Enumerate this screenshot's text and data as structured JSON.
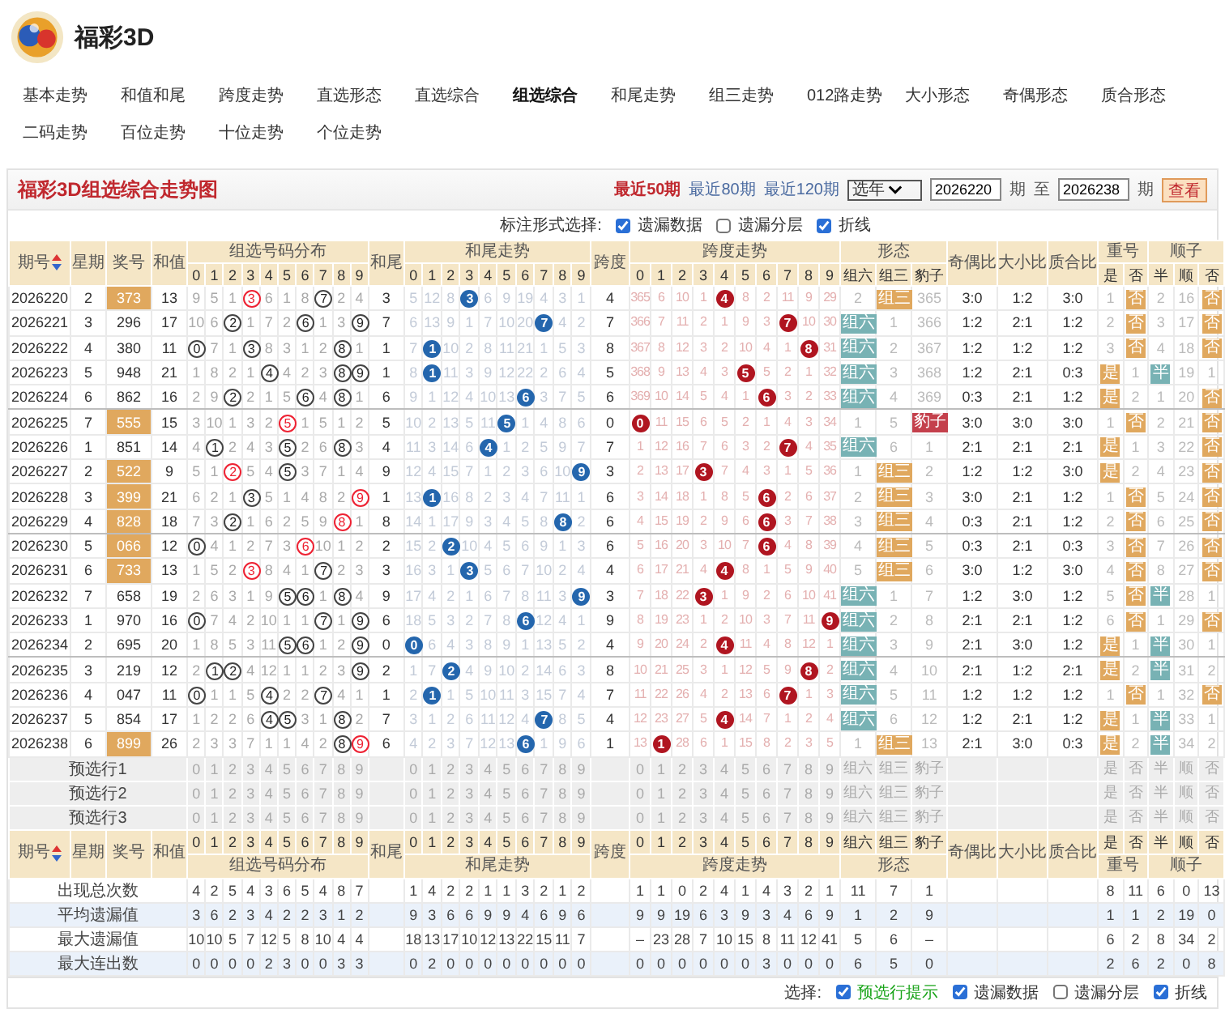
{
  "app": {
    "title": "福彩3D"
  },
  "nav": [
    {
      "label": "基本走势",
      "selected": false
    },
    {
      "label": "和值和尾",
      "selected": false
    },
    {
      "label": "跨度走势",
      "selected": false
    },
    {
      "label": "直选形态",
      "selected": false
    },
    {
      "label": "直选综合",
      "selected": false
    },
    {
      "label": "组选综合",
      "selected": true
    },
    {
      "label": "和尾走势",
      "selected": false
    },
    {
      "label": "组三走势",
      "selected": false
    },
    {
      "label": "012路走势",
      "selected": false
    },
    {
      "label": "大小形态",
      "selected": false
    },
    {
      "label": "奇偶形态",
      "selected": false
    },
    {
      "label": "质合形态",
      "selected": false
    },
    {
      "label": "二码走势",
      "selected": false
    },
    {
      "label": "百位走势",
      "selected": false
    },
    {
      "label": "十位走势",
      "selected": false
    },
    {
      "label": "个位走势",
      "selected": false
    }
  ],
  "panel": {
    "title": "福彩3D组选综合走势图",
    "ranges": [
      {
        "label": "最近50期",
        "selected": true
      },
      {
        "label": "最近80期",
        "selected": false
      },
      {
        "label": "最近120期",
        "selected": false
      }
    ],
    "year_select": "选年",
    "from": "2026220",
    "from_unit": "期",
    "to_label": "至",
    "to": "2026238",
    "to_unit": "期",
    "view_button": "查看"
  },
  "mark_options": {
    "label": "标注形式选择:",
    "items": [
      {
        "label": "遗漏数据",
        "checked": true
      },
      {
        "label": "遗漏分层",
        "checked": false
      },
      {
        "label": "折线",
        "checked": true
      }
    ]
  },
  "table": {
    "header": {
      "period": "期号",
      "week": "星期",
      "number": "奖号",
      "sum": "和值",
      "dist_title": "组选号码分布",
      "dist_digits": [
        "0",
        "1",
        "2",
        "3",
        "4",
        "5",
        "6",
        "7",
        "8",
        "9"
      ],
      "tail": "和尾",
      "tail_title": "和尾走势",
      "tail_digits": [
        "0",
        "1",
        "2",
        "3",
        "4",
        "5",
        "6",
        "7",
        "8",
        "9"
      ],
      "span": "跨度",
      "span_title": "跨度走势",
      "span_digits": [
        "0",
        "1",
        "2",
        "3",
        "4",
        "5",
        "6",
        "7",
        "8",
        "9"
      ],
      "form_title": "形态",
      "form_cols": [
        "组六",
        "组三",
        "豹子"
      ],
      "odd_even": "奇偶比",
      "big_small": "大小比",
      "prime": "质合比",
      "repeat_title": "重号",
      "repeat_cols": [
        "是",
        "否"
      ],
      "seq_title": "顺子",
      "seq_cols": [
        "半",
        "顺",
        "否"
      ]
    },
    "rows": [
      {
        "period": "2026220",
        "weekday": "2",
        "number": "373",
        "highlight": true,
        "sum": "13",
        "dist": [
          "9",
          "5",
          "1",
          {
            "t": "3",
            "hit": true,
            "double": true
          },
          "6",
          "1",
          "8",
          {
            "t": "7",
            "hit": true,
            "double": false
          },
          "2",
          "4"
        ],
        "tail": "3",
        "tail_trend": [
          "5",
          "12",
          "8",
          {
            "t": "3",
            "hit": true
          },
          "6",
          "9",
          "19",
          "4",
          "3",
          "1"
        ],
        "span": "4",
        "span_trend": [
          "365",
          "6",
          "10",
          "1",
          {
            "t": "4",
            "hit": true
          },
          "8",
          "2",
          "11",
          "9",
          "29"
        ],
        "form": [
          "2",
          {
            "t": "组三",
            "hit": true
          },
          "365"
        ],
        "odd_even": "3:0",
        "big_small": "1:2",
        "prime": "3:0",
        "repeat": [
          "1",
          {
            "t": "否",
            "hit": true
          }
        ],
        "sequence": [
          "2",
          "16",
          {
            "t": "否",
            "hit": true
          }
        ]
      },
      {
        "period": "2026221",
        "weekday": "3",
        "number": "296",
        "highlight": false,
        "sum": "17",
        "dist": [
          "10",
          "6",
          {
            "t": "2",
            "hit": true,
            "double": false
          },
          "1",
          "7",
          "2",
          {
            "t": "6",
            "hit": true,
            "double": false
          },
          "1",
          "3",
          {
            "t": "9",
            "hit": true,
            "double": false
          }
        ],
        "tail": "7",
        "tail_trend": [
          "6",
          "13",
          "9",
          "1",
          "7",
          "10",
          "20",
          {
            "t": "7",
            "hit": true
          },
          "4",
          "2"
        ],
        "span": "7",
        "span_trend": [
          "366",
          "7",
          "11",
          "2",
          "1",
          "9",
          "3",
          {
            "t": "7",
            "hit": true
          },
          "10",
          "30"
        ],
        "form": [
          {
            "t": "组六",
            "hit": true
          },
          "1",
          "366"
        ],
        "odd_even": "1:2",
        "big_small": "2:1",
        "prime": "1:2",
        "repeat": [
          "2",
          {
            "t": "否",
            "hit": true
          }
        ],
        "sequence": [
          "3",
          "17",
          {
            "t": "否",
            "hit": true
          }
        ]
      },
      {
        "period": "2026222",
        "weekday": "4",
        "number": "380",
        "highlight": false,
        "sum": "11",
        "dist": [
          {
            "t": "0",
            "hit": true,
            "double": false
          },
          "7",
          "1",
          {
            "t": "3",
            "hit": true,
            "double": false
          },
          "8",
          "3",
          "1",
          "2",
          {
            "t": "8",
            "hit": true,
            "double": false
          },
          "1"
        ],
        "tail": "1",
        "tail_trend": [
          "7",
          {
            "t": "1",
            "hit": true
          },
          "10",
          "2",
          "8",
          "11",
          "21",
          "1",
          "5",
          "3"
        ],
        "span": "8",
        "span_trend": [
          "367",
          "8",
          "12",
          "3",
          "2",
          "10",
          "4",
          "1",
          {
            "t": "8",
            "hit": true
          },
          "31"
        ],
        "form": [
          {
            "t": "组六",
            "hit": true
          },
          "2",
          "367"
        ],
        "odd_even": "1:2",
        "big_small": "1:2",
        "prime": "1:2",
        "repeat": [
          "3",
          {
            "t": "否",
            "hit": true
          }
        ],
        "sequence": [
          "4",
          "18",
          {
            "t": "否",
            "hit": true
          }
        ]
      },
      {
        "period": "2026223",
        "weekday": "5",
        "number": "948",
        "highlight": false,
        "sum": "21",
        "dist": [
          "1",
          "8",
          "2",
          "1",
          {
            "t": "4",
            "hit": true,
            "double": false
          },
          "4",
          "2",
          "3",
          {
            "t": "8",
            "hit": true,
            "double": false
          },
          {
            "t": "9",
            "hit": true,
            "double": false
          }
        ],
        "tail": "1",
        "tail_trend": [
          "8",
          {
            "t": "1",
            "hit": true
          },
          "11",
          "3",
          "9",
          "12",
          "22",
          "2",
          "6",
          "4"
        ],
        "span": "5",
        "span_trend": [
          "368",
          "9",
          "13",
          "4",
          "3",
          {
            "t": "5",
            "hit": true
          },
          "5",
          "2",
          "1",
          "32"
        ],
        "form": [
          {
            "t": "组六",
            "hit": true
          },
          "3",
          "368"
        ],
        "odd_even": "1:2",
        "big_small": "2:1",
        "prime": "0:3",
        "repeat": [
          {
            "t": "是",
            "hit": true
          },
          "1"
        ],
        "sequence": [
          {
            "t": "半",
            "hit": true
          },
          "19",
          "1"
        ]
      },
      {
        "period": "2026224",
        "weekday": "6",
        "number": "862",
        "highlight": false,
        "sum": "16",
        "dist": [
          "2",
          "9",
          {
            "t": "2",
            "hit": true,
            "double": false
          },
          "2",
          "1",
          "5",
          {
            "t": "6",
            "hit": true,
            "double": false
          },
          "4",
          {
            "t": "8",
            "hit": true,
            "double": false
          },
          "1"
        ],
        "tail": "6",
        "tail_trend": [
          "9",
          "1",
          "12",
          "4",
          "10",
          "13",
          {
            "t": "6",
            "hit": true
          },
          "3",
          "7",
          "5"
        ],
        "span": "6",
        "span_trend": [
          "369",
          "10",
          "14",
          "5",
          "4",
          "1",
          {
            "t": "6",
            "hit": true
          },
          "3",
          "2",
          "33"
        ],
        "form": [
          {
            "t": "组六",
            "hit": true
          },
          "4",
          "369"
        ],
        "odd_even": "0:3",
        "big_small": "2:1",
        "prime": "1:2",
        "repeat": [
          {
            "t": "是",
            "hit": true
          },
          "2"
        ],
        "sequence": [
          "1",
          "20",
          {
            "t": "否",
            "hit": true
          }
        ]
      },
      {
        "period": "2026225",
        "weekday": "7",
        "number": "555",
        "highlight": true,
        "sum": "15",
        "dist": [
          "3",
          "10",
          "1",
          "3",
          "2",
          {
            "t": "5",
            "hit": true,
            "double": true
          },
          "1",
          "5",
          "1",
          "2"
        ],
        "tail": "5",
        "tail_trend": [
          "10",
          "2",
          "13",
          "5",
          "11",
          {
            "t": "5",
            "hit": true
          },
          "1",
          "4",
          "8",
          "6"
        ],
        "span": "0",
        "span_trend": [
          {
            "t": "0",
            "hit": true
          },
          "11",
          "15",
          "6",
          "5",
          "2",
          "1",
          "4",
          "3",
          "34"
        ],
        "form": [
          "1",
          "5",
          {
            "t": "豹子",
            "hit": true
          }
        ],
        "odd_even": "3:0",
        "big_small": "3:0",
        "prime": "3:0",
        "repeat": [
          "1",
          {
            "t": "否",
            "hit": true
          }
        ],
        "sequence": [
          "2",
          "21",
          {
            "t": "否",
            "hit": true
          }
        ]
      },
      {
        "period": "2026226",
        "weekday": "1",
        "number": "851",
        "highlight": false,
        "sum": "14",
        "dist": [
          "4",
          {
            "t": "1",
            "hit": true,
            "double": false
          },
          "2",
          "4",
          "3",
          {
            "t": "5",
            "hit": true,
            "double": false
          },
          "2",
          "6",
          {
            "t": "8",
            "hit": true,
            "double": false
          },
          "3"
        ],
        "tail": "4",
        "tail_trend": [
          "11",
          "3",
          "14",
          "6",
          {
            "t": "4",
            "hit": true
          },
          "1",
          "2",
          "5",
          "9",
          "7"
        ],
        "span": "7",
        "span_trend": [
          "1",
          "12",
          "16",
          "7",
          "6",
          "3",
          "2",
          {
            "t": "7",
            "hit": true
          },
          "4",
          "35"
        ],
        "form": [
          {
            "t": "组六",
            "hit": true
          },
          "6",
          "1"
        ],
        "odd_even": "2:1",
        "big_small": "2:1",
        "prime": "2:1",
        "repeat": [
          {
            "t": "是",
            "hit": true
          },
          "1"
        ],
        "sequence": [
          "3",
          "22",
          {
            "t": "否",
            "hit": true
          }
        ]
      },
      {
        "period": "2026227",
        "weekday": "2",
        "number": "522",
        "highlight": true,
        "sum": "9",
        "dist": [
          "5",
          "1",
          {
            "t": "2",
            "hit": true,
            "double": true
          },
          "5",
          "4",
          {
            "t": "5",
            "hit": true,
            "double": false
          },
          "3",
          "7",
          "1",
          "4"
        ],
        "tail": "9",
        "tail_trend": [
          "12",
          "4",
          "15",
          "7",
          "1",
          "2",
          "3",
          "6",
          "10",
          {
            "t": "9",
            "hit": true
          }
        ],
        "span": "3",
        "span_trend": [
          "2",
          "13",
          "17",
          {
            "t": "3",
            "hit": true
          },
          "7",
          "4",
          "3",
          "1",
          "5",
          "36"
        ],
        "form": [
          "1",
          {
            "t": "组三",
            "hit": true
          },
          "2"
        ],
        "odd_even": "1:2",
        "big_small": "1:2",
        "prime": "3:0",
        "repeat": [
          {
            "t": "是",
            "hit": true
          },
          "2"
        ],
        "sequence": [
          "4",
          "23",
          {
            "t": "否",
            "hit": true
          }
        ]
      },
      {
        "period": "2026228",
        "weekday": "3",
        "number": "399",
        "highlight": true,
        "sum": "21",
        "dist": [
          "6",
          "2",
          "1",
          {
            "t": "3",
            "hit": true,
            "double": false
          },
          "5",
          "1",
          "4",
          "8",
          "2",
          {
            "t": "9",
            "hit": true,
            "double": true
          }
        ],
        "tail": "1",
        "tail_trend": [
          "13",
          {
            "t": "1",
            "hit": true
          },
          "16",
          "8",
          "2",
          "3",
          "4",
          "7",
          "11",
          "1"
        ],
        "span": "6",
        "span_trend": [
          "3",
          "14",
          "18",
          "1",
          "8",
          "5",
          {
            "t": "6",
            "hit": true
          },
          "2",
          "6",
          "37"
        ],
        "form": [
          "2",
          {
            "t": "组三",
            "hit": true
          },
          "3"
        ],
        "odd_even": "3:0",
        "big_small": "2:1",
        "prime": "1:2",
        "repeat": [
          "1",
          {
            "t": "否",
            "hit": true
          }
        ],
        "sequence": [
          "5",
          "24",
          {
            "t": "否",
            "hit": true
          }
        ]
      },
      {
        "period": "2026229",
        "weekday": "4",
        "number": "828",
        "highlight": true,
        "sum": "18",
        "dist": [
          "7",
          "3",
          {
            "t": "2",
            "hit": true,
            "double": false
          },
          "1",
          "6",
          "2",
          "5",
          "9",
          {
            "t": "8",
            "hit": true,
            "double": true
          },
          "1"
        ],
        "tail": "8",
        "tail_trend": [
          "14",
          "1",
          "17",
          "9",
          "3",
          "4",
          "5",
          "8",
          {
            "t": "8",
            "hit": true
          },
          "2"
        ],
        "span": "6",
        "span_trend": [
          "4",
          "15",
          "19",
          "2",
          "9",
          "6",
          {
            "t": "6",
            "hit": true
          },
          "3",
          "7",
          "38"
        ],
        "form": [
          "3",
          {
            "t": "组三",
            "hit": true
          },
          "4"
        ],
        "odd_even": "0:3",
        "big_small": "2:1",
        "prime": "1:2",
        "repeat": [
          "2",
          {
            "t": "否",
            "hit": true
          }
        ],
        "sequence": [
          "6",
          "25",
          {
            "t": "否",
            "hit": true
          }
        ]
      },
      {
        "period": "2026230",
        "weekday": "5",
        "number": "066",
        "highlight": true,
        "sum": "12",
        "dist": [
          {
            "t": "0",
            "hit": true,
            "double": false
          },
          "4",
          "1",
          "2",
          "7",
          "3",
          {
            "t": "6",
            "hit": true,
            "double": true
          },
          "10",
          "1",
          "2"
        ],
        "tail": "2",
        "tail_trend": [
          "15",
          "2",
          {
            "t": "2",
            "hit": true
          },
          "10",
          "4",
          "5",
          "6",
          "9",
          "1",
          "3"
        ],
        "span": "6",
        "span_trend": [
          "5",
          "16",
          "20",
          "3",
          "10",
          "7",
          {
            "t": "6",
            "hit": true
          },
          "4",
          "8",
          "39"
        ],
        "form": [
          "4",
          {
            "t": "组三",
            "hit": true
          },
          "5"
        ],
        "odd_even": "0:3",
        "big_small": "2:1",
        "prime": "0:3",
        "repeat": [
          "3",
          {
            "t": "否",
            "hit": true
          }
        ],
        "sequence": [
          "7",
          "26",
          {
            "t": "否",
            "hit": true
          }
        ]
      },
      {
        "period": "2026231",
        "weekday": "6",
        "number": "733",
        "highlight": true,
        "sum": "13",
        "dist": [
          "1",
          "5",
          "2",
          {
            "t": "3",
            "hit": true,
            "double": true
          },
          "8",
          "4",
          "1",
          {
            "t": "7",
            "hit": true,
            "double": false
          },
          "2",
          "3"
        ],
        "tail": "3",
        "tail_trend": [
          "16",
          "3",
          "1",
          {
            "t": "3",
            "hit": true
          },
          "5",
          "6",
          "7",
          "10",
          "2",
          "4"
        ],
        "span": "4",
        "span_trend": [
          "6",
          "17",
          "21",
          "4",
          {
            "t": "4",
            "hit": true
          },
          "8",
          "1",
          "5",
          "9",
          "40"
        ],
        "form": [
          "5",
          {
            "t": "组三",
            "hit": true
          },
          "6"
        ],
        "odd_even": "3:0",
        "big_small": "1:2",
        "prime": "3:0",
        "repeat": [
          "4",
          {
            "t": "否",
            "hit": true
          }
        ],
        "sequence": [
          "8",
          "27",
          {
            "t": "否",
            "hit": true
          }
        ]
      },
      {
        "period": "2026232",
        "weekday": "7",
        "number": "658",
        "highlight": false,
        "sum": "19",
        "dist": [
          "2",
          "6",
          "3",
          "1",
          "9",
          {
            "t": "5",
            "hit": true,
            "double": false
          },
          {
            "t": "6",
            "hit": true,
            "double": false
          },
          "1",
          {
            "t": "8",
            "hit": true,
            "double": false
          },
          "4"
        ],
        "tail": "9",
        "tail_trend": [
          "17",
          "4",
          "2",
          "1",
          "6",
          "7",
          "8",
          "11",
          "3",
          {
            "t": "9",
            "hit": true
          }
        ],
        "span": "3",
        "span_trend": [
          "7",
          "18",
          "22",
          {
            "t": "3",
            "hit": true
          },
          "1",
          "9",
          "2",
          "6",
          "10",
          "41"
        ],
        "form": [
          {
            "t": "组六",
            "hit": true
          },
          "1",
          "7"
        ],
        "odd_even": "1:2",
        "big_small": "3:0",
        "prime": "1:2",
        "repeat": [
          "5",
          {
            "t": "否",
            "hit": true
          }
        ],
        "sequence": [
          {
            "t": "半",
            "hit": true
          },
          "28",
          "1"
        ]
      },
      {
        "period": "2026233",
        "weekday": "1",
        "number": "970",
        "highlight": false,
        "sum": "16",
        "dist": [
          {
            "t": "0",
            "hit": true,
            "double": false
          },
          "7",
          "4",
          "2",
          "10",
          "1",
          "1",
          {
            "t": "7",
            "hit": true,
            "double": false
          },
          "1",
          {
            "t": "9",
            "hit": true,
            "double": false
          }
        ],
        "tail": "6",
        "tail_trend": [
          "18",
          "5",
          "3",
          "2",
          "7",
          "8",
          {
            "t": "6",
            "hit": true
          },
          "12",
          "4",
          "1"
        ],
        "span": "9",
        "span_trend": [
          "8",
          "19",
          "23",
          "1",
          "2",
          "10",
          "3",
          "7",
          "11",
          {
            "t": "9",
            "hit": true
          }
        ],
        "form": [
          {
            "t": "组六",
            "hit": true
          },
          "2",
          "8"
        ],
        "odd_even": "2:1",
        "big_small": "2:1",
        "prime": "1:2",
        "repeat": [
          "6",
          {
            "t": "否",
            "hit": true
          }
        ],
        "sequence": [
          "1",
          "29",
          {
            "t": "否",
            "hit": true
          }
        ]
      },
      {
        "period": "2026234",
        "weekday": "2",
        "number": "695",
        "highlight": false,
        "sum": "20",
        "dist": [
          "1",
          "8",
          "5",
          "3",
          "11",
          {
            "t": "5",
            "hit": true,
            "double": false
          },
          {
            "t": "6",
            "hit": true,
            "double": false
          },
          "1",
          "2",
          {
            "t": "9",
            "hit": true,
            "double": false
          }
        ],
        "tail": "0",
        "tail_trend": [
          {
            "t": "0",
            "hit": true
          },
          "6",
          "4",
          "3",
          "8",
          "9",
          "1",
          "13",
          "5",
          "2"
        ],
        "span": "4",
        "span_trend": [
          "9",
          "20",
          "24",
          "2",
          {
            "t": "4",
            "hit": true
          },
          "11",
          "4",
          "8",
          "12",
          "1"
        ],
        "form": [
          {
            "t": "组六",
            "hit": true
          },
          "3",
          "9"
        ],
        "odd_even": "2:1",
        "big_small": "3:0",
        "prime": "1:2",
        "repeat": [
          {
            "t": "是",
            "hit": true
          },
          "1"
        ],
        "sequence": [
          {
            "t": "半",
            "hit": true
          },
          "30",
          "1"
        ]
      },
      {
        "period": "2026235",
        "weekday": "3",
        "number": "219",
        "highlight": false,
        "sum": "12",
        "dist": [
          "2",
          {
            "t": "1",
            "hit": true,
            "double": false
          },
          {
            "t": "2",
            "hit": true,
            "double": false
          },
          "4",
          "12",
          "1",
          "1",
          "2",
          "3",
          {
            "t": "9",
            "hit": true,
            "double": false
          }
        ],
        "tail": "2",
        "tail_trend": [
          "1",
          "7",
          {
            "t": "2",
            "hit": true
          },
          "4",
          "9",
          "10",
          "2",
          "14",
          "6",
          "3"
        ],
        "span": "8",
        "span_trend": [
          "10",
          "21",
          "25",
          "3",
          "1",
          "12",
          "5",
          "9",
          {
            "t": "8",
            "hit": true
          },
          "2"
        ],
        "form": [
          {
            "t": "组六",
            "hit": true
          },
          "4",
          "10"
        ],
        "odd_even": "2:1",
        "big_small": "1:2",
        "prime": "2:1",
        "repeat": [
          {
            "t": "是",
            "hit": true
          },
          "2"
        ],
        "sequence": [
          {
            "t": "半",
            "hit": true
          },
          "31",
          "2"
        ]
      },
      {
        "period": "2026236",
        "weekday": "4",
        "number": "047",
        "highlight": false,
        "sum": "11",
        "dist": [
          {
            "t": "0",
            "hit": true,
            "double": false
          },
          "1",
          "1",
          "5",
          {
            "t": "4",
            "hit": true,
            "double": false
          },
          "2",
          "2",
          {
            "t": "7",
            "hit": true,
            "double": false
          },
          "4",
          "1"
        ],
        "tail": "1",
        "tail_trend": [
          "2",
          {
            "t": "1",
            "hit": true
          },
          "1",
          "5",
          "10",
          "11",
          "3",
          "15",
          "7",
          "4"
        ],
        "span": "7",
        "span_trend": [
          "11",
          "22",
          "26",
          "4",
          "2",
          "13",
          "6",
          {
            "t": "7",
            "hit": true
          },
          "1",
          "3"
        ],
        "form": [
          {
            "t": "组六",
            "hit": true
          },
          "5",
          "11"
        ],
        "odd_even": "1:2",
        "big_small": "1:2",
        "prime": "1:2",
        "repeat": [
          "1",
          {
            "t": "否",
            "hit": true
          }
        ],
        "sequence": [
          "1",
          "32",
          {
            "t": "否",
            "hit": true
          }
        ]
      },
      {
        "period": "2026237",
        "weekday": "5",
        "number": "854",
        "highlight": false,
        "sum": "17",
        "dist": [
          "1",
          "2",
          "2",
          "6",
          {
            "t": "4",
            "hit": true,
            "double": false
          },
          {
            "t": "5",
            "hit": true,
            "double": false
          },
          "3",
          "1",
          {
            "t": "8",
            "hit": true,
            "double": false
          },
          "2"
        ],
        "tail": "7",
        "tail_trend": [
          "3",
          "1",
          "2",
          "6",
          "11",
          "12",
          "4",
          {
            "t": "7",
            "hit": true
          },
          "8",
          "5"
        ],
        "span": "4",
        "span_trend": [
          "12",
          "23",
          "27",
          "5",
          {
            "t": "4",
            "hit": true
          },
          "14",
          "7",
          "1",
          "2",
          "4"
        ],
        "form": [
          {
            "t": "组六",
            "hit": true
          },
          "6",
          "12"
        ],
        "odd_even": "1:2",
        "big_small": "2:1",
        "prime": "1:2",
        "repeat": [
          {
            "t": "是",
            "hit": true
          },
          "1"
        ],
        "sequence": [
          {
            "t": "半",
            "hit": true
          },
          "33",
          "1"
        ]
      },
      {
        "period": "2026238",
        "weekday": "6",
        "number": "899",
        "highlight": true,
        "sum": "26",
        "dist": [
          "2",
          "3",
          "3",
          "7",
          "1",
          "1",
          "4",
          "2",
          {
            "t": "8",
            "hit": true,
            "double": false
          },
          {
            "t": "9",
            "hit": true,
            "double": true
          }
        ],
        "tail": "6",
        "tail_trend": [
          "4",
          "2",
          "3",
          "7",
          "12",
          "13",
          {
            "t": "6",
            "hit": true
          },
          "1",
          "9",
          "6"
        ],
        "span": "1",
        "span_trend": [
          "13",
          {
            "t": "1",
            "hit": true
          },
          "28",
          "6",
          "1",
          "15",
          "8",
          "2",
          "3",
          "5"
        ],
        "form": [
          "1",
          {
            "t": "组三",
            "hit": true
          },
          "13"
        ],
        "odd_even": "2:1",
        "big_small": "3:0",
        "prime": "0:3",
        "repeat": [
          {
            "t": "是",
            "hit": true
          },
          "2"
        ],
        "sequence": [
          {
            "t": "半",
            "hit": true
          },
          "34",
          "2"
        ]
      }
    ],
    "preselect_rows": [
      {
        "label": "预选行1",
        "dist": [
          "0",
          "1",
          "2",
          "3",
          "4",
          "5",
          "6",
          "7",
          "8",
          "9"
        ],
        "tail_trend": [
          "0",
          "1",
          "2",
          "3",
          "4",
          "5",
          "6",
          "7",
          "8",
          "9"
        ],
        "span_trend": [
          "0",
          "1",
          "2",
          "3",
          "4",
          "5",
          "6",
          "7",
          "8",
          "9"
        ],
        "form": [
          "组六",
          "组三",
          "豹子"
        ],
        "repeat": [
          "是",
          "否"
        ],
        "sequence": [
          "半",
          "顺",
          "否"
        ]
      },
      {
        "label": "预选行2",
        "dist": [
          "0",
          "1",
          "2",
          "3",
          "4",
          "5",
          "6",
          "7",
          "8",
          "9"
        ],
        "tail_trend": [
          "0",
          "1",
          "2",
          "3",
          "4",
          "5",
          "6",
          "7",
          "8",
          "9"
        ],
        "span_trend": [
          "0",
          "1",
          "2",
          "3",
          "4",
          "5",
          "6",
          "7",
          "8",
          "9"
        ],
        "form": [
          "组六",
          "组三",
          "豹子"
        ],
        "repeat": [
          "是",
          "否"
        ],
        "sequence": [
          "半",
          "顺",
          "否"
        ]
      },
      {
        "label": "预选行3",
        "dist": [
          "0",
          "1",
          "2",
          "3",
          "4",
          "5",
          "6",
          "7",
          "8",
          "9"
        ],
        "tail_trend": [
          "0",
          "1",
          "2",
          "3",
          "4",
          "5",
          "6",
          "7",
          "8",
          "9"
        ],
        "span_trend": [
          "0",
          "1",
          "2",
          "3",
          "4",
          "5",
          "6",
          "7",
          "8",
          "9"
        ],
        "form": [
          "组六",
          "组三",
          "豹子"
        ],
        "repeat": [
          "是",
          "否"
        ],
        "sequence": [
          "半",
          "顺",
          "否"
        ]
      }
    ],
    "footer_header": {
      "period": "期号",
      "week": "星期",
      "number": "奖号",
      "sum": "和值",
      "dist_title": "组选号码分布",
      "dist_digits": [
        "0",
        "1",
        "2",
        "3",
        "4",
        "5",
        "6",
        "7",
        "8",
        "9"
      ],
      "tail": "和尾",
      "tail_title": "和尾走势",
      "tail_digits": [
        "0",
        "1",
        "2",
        "3",
        "4",
        "5",
        "6",
        "7",
        "8",
        "9"
      ],
      "span": "跨度",
      "span_title": "跨度走势",
      "span_digits": [
        "0",
        "1",
        "2",
        "3",
        "4",
        "5",
        "6",
        "7",
        "8",
        "9"
      ],
      "form_title": "形态",
      "form_cols": [
        "组六",
        "组三",
        "豹子"
      ],
      "odd_even": "奇偶比",
      "big_small": "大小比",
      "prime": "质合比",
      "repeat_title": "重号",
      "repeat_cols": [
        "是",
        "否"
      ],
      "seq_title": "顺子",
      "seq_cols": [
        "半",
        "顺",
        "否"
      ]
    },
    "stats": [
      {
        "label": "出现总次数",
        "dist": [
          "4",
          "2",
          "5",
          "4",
          "3",
          "6",
          "5",
          "4",
          "8",
          "7"
        ],
        "tail_trend": [
          "1",
          "4",
          "2",
          "2",
          "1",
          "1",
          "3",
          "2",
          "1",
          "2"
        ],
        "span_trend": [
          "1",
          "1",
          "0",
          "2",
          "4",
          "1",
          "4",
          "3",
          "2",
          "1"
        ],
        "form": [
          "11",
          "7",
          "1"
        ],
        "repeat": [
          "8",
          "11"
        ],
        "sequence": [
          "6",
          "0",
          "13"
        ]
      },
      {
        "label": "平均遗漏值",
        "dist": [
          "3",
          "6",
          "2",
          "3",
          "4",
          "2",
          "2",
          "3",
          "1",
          "2"
        ],
        "tail_trend": [
          "9",
          "3",
          "6",
          "6",
          "9",
          "9",
          "4",
          "6",
          "9",
          "6"
        ],
        "span_trend": [
          "9",
          "9",
          "19",
          "6",
          "3",
          "9",
          "3",
          "4",
          "6",
          "9"
        ],
        "form": [
          "1",
          "2",
          "9"
        ],
        "repeat": [
          "1",
          "1"
        ],
        "sequence": [
          "2",
          "19",
          "0"
        ]
      },
      {
        "label": "最大遗漏值",
        "dist": [
          "10",
          "10",
          "5",
          "7",
          "12",
          "5",
          "8",
          "10",
          "4",
          "4"
        ],
        "tail_trend": [
          "18",
          "13",
          "17",
          "10",
          "12",
          "13",
          "22",
          "15",
          "11",
          "7"
        ],
        "span_trend": [
          "–",
          "23",
          "28",
          "7",
          "10",
          "15",
          "8",
          "11",
          "12",
          "41"
        ],
        "form": [
          "5",
          "6",
          "–"
        ],
        "repeat": [
          "6",
          "2"
        ],
        "sequence": [
          "8",
          "34",
          "2"
        ]
      },
      {
        "label": "最大连出数",
        "dist": [
          "0",
          "0",
          "0",
          "0",
          "2",
          "3",
          "0",
          "0",
          "3",
          "3"
        ],
        "tail_trend": [
          "0",
          "2",
          "0",
          "0",
          "0",
          "0",
          "0",
          "0",
          "0",
          "0"
        ],
        "span_trend": [
          "0",
          "0",
          "0",
          "0",
          "0",
          "0",
          "3",
          "0",
          "0",
          "0"
        ],
        "form": [
          "6",
          "5",
          "0"
        ],
        "repeat": [
          "2",
          "6"
        ],
        "sequence": [
          "2",
          "0",
          "8"
        ]
      }
    ]
  },
  "bottom_options": {
    "label": "选择:",
    "items": [
      {
        "label": "预选行提示",
        "checked": true,
        "kind": "hint"
      },
      {
        "label": "遗漏数据",
        "checked": true,
        "kind": "plain"
      },
      {
        "label": "遗漏分层",
        "checked": false,
        "kind": "plain"
      },
      {
        "label": "折线",
        "checked": true,
        "kind": "plain"
      }
    ]
  }
}
